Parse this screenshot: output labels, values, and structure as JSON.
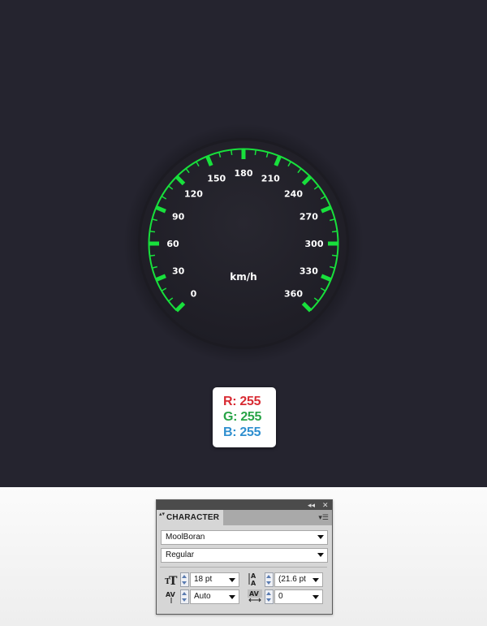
{
  "gauge": {
    "unit_label": "km/h",
    "tick_labels": [
      "0",
      "30",
      "60",
      "90",
      "120",
      "150",
      "180",
      "210",
      "240",
      "270",
      "300",
      "330",
      "360"
    ],
    "accent_color": "#18e03c",
    "label_color": "#ffffff",
    "dial_color": "#24232c",
    "background_color": "#25242f"
  },
  "rgb_note": {
    "r_text": "R: 255",
    "g_text": "G: 255",
    "b_text": "B: 255",
    "r_color": "#d82b33",
    "g_color": "#28a447",
    "b_color": "#2f8fcf"
  },
  "character_panel": {
    "title": "CHARACTER",
    "font_family_value": "MoolBoran",
    "font_style_value": "Regular",
    "font_size_value": "18 pt",
    "leading_value": "(21.6 pt",
    "kerning_value": "Auto",
    "tracking_value": "0",
    "collapse_glyph": "◂◂",
    "close_glyph": "✕",
    "menu_glyph": "▾☰",
    "tab_arrows_glyph": "▴▾"
  },
  "icons": {
    "font_size": "font-size-icon",
    "leading": "leading-icon",
    "kerning": "kerning-icon",
    "tracking": "tracking-icon"
  }
}
